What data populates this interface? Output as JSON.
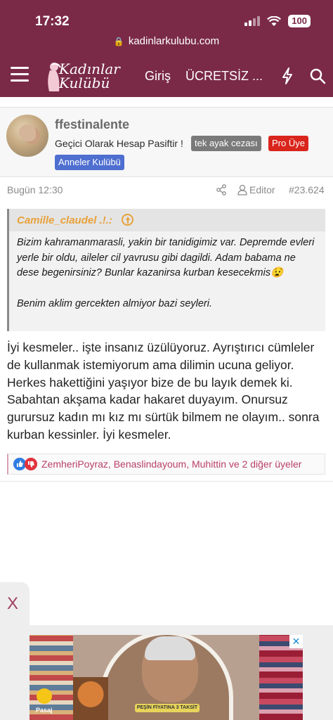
{
  "status_bar": {
    "time": "17:32",
    "battery": "100"
  },
  "browser": {
    "url": "kadinlarkulubu.com"
  },
  "nav": {
    "logo_text": "Kadınlar Kulübü",
    "login_label": "Giriş",
    "register_label": "ÜCRETSİZ ..."
  },
  "post": {
    "username": "ffestinalente",
    "user_title": "Geçici Olarak Hesap Pasiftir !",
    "badges": {
      "gray": "tek ayak cezası",
      "red": "Pro Üye",
      "blue": "Anneler Kulübü"
    },
    "date": "Bugün 12:30",
    "editor_label": "Editor",
    "post_number": "#23.624",
    "quote": {
      "author": "Camille_claudel .!.:",
      "paragraph1": "Bizim kahramanmarasli, yakin bir tanidigimiz var. Depremde evleri yerle bir oldu, aileler cil yavrusu gibi dagildi. Adam babama ne dese begenirsiniz? Bunlar kazanirsa kurban kesecekmis😧",
      "paragraph2": "Benim aklim gercekten almiyor bazi seyleri."
    },
    "body": "İyi kesmeler.. işte insanız üzülüyoruz. Ayrıştırıcı cümleler de kullanmak istemiyorum ama dilimin ucuna geliyor. Herkes hakettiğini yaşıyor bize de bu layık demek ki. Sabahtan akşama kadar hakaret duyayım. Onursuz gurursuz kadın mı kız mı sürtük bilmem ne olayım.. sonra kurban kessinler. İyi kesmeler.",
    "reactions_text": "ZemheriPoyraz, Benaslindayoum, Muhittin ve 2 diğer üyeler"
  },
  "ad": {
    "close_label": "X",
    "brand": "Pasaj",
    "banner_text": "PEŞİN FİYATINA 3 TAKSİT"
  },
  "colors": {
    "brand": "#7a2a47",
    "accent": "#b94166",
    "quote_author": "#e8a13a"
  }
}
